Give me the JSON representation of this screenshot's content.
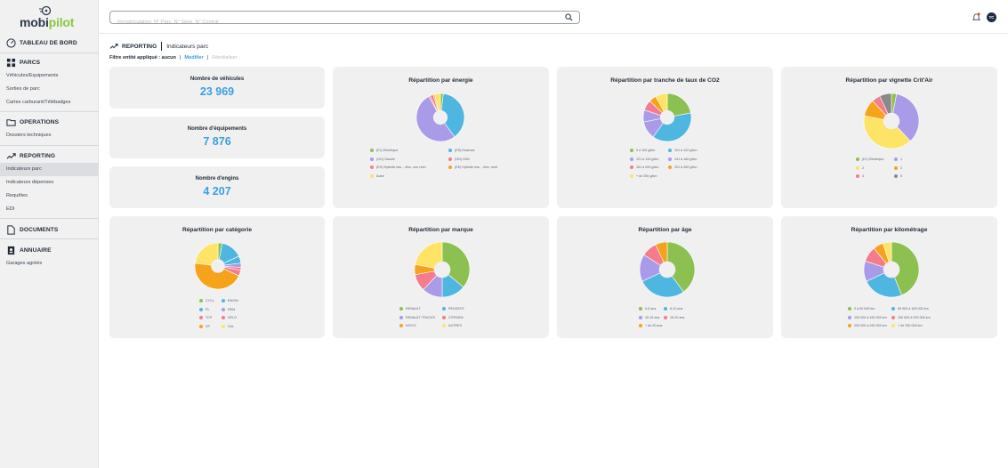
{
  "brand": {
    "name_part1": "mobi",
    "name_part2": "pilot"
  },
  "sidebar": {
    "sections": [
      {
        "icon": "gauge-icon",
        "title": "TABLEAU DE BORD",
        "items": []
      },
      {
        "icon": "grid-icon",
        "title": "PARCS",
        "items": [
          "Véhicules/Equipements",
          "Sorties de parc",
          "Cartes carburant/Télébadges"
        ]
      },
      {
        "icon": "folder-icon",
        "title": "OPERATIONS",
        "items": [
          "Dossiers techniques"
        ]
      },
      {
        "icon": "trend-icon",
        "title": "REPORTING",
        "items": [
          "Indicateurs parc",
          "Indicateurs dépenses",
          "Requêtes",
          "EDI"
        ]
      },
      {
        "icon": "document-icon",
        "title": "DOCUMENTS",
        "items": []
      },
      {
        "icon": "contacts-icon",
        "title": "ANNUAIRE",
        "items": [
          "Garages agréés"
        ]
      }
    ],
    "active_item": "Indicateurs parc"
  },
  "topbar": {
    "search_placeholder": "Immatriculation, N° Parc, N° Série, N° Contrat",
    "avatar_initials": "TC"
  },
  "header": {
    "section": "REPORTING",
    "page": "Indicateurs parc",
    "filter_label": "Filtre entité appliqué : aucun",
    "separator": "|",
    "modify": "Modifier",
    "reset": "Réinitialiser"
  },
  "kpis": [
    {
      "label": "Nombre de véhicules",
      "value": "23 969"
    },
    {
      "label": "Nombre d'équipements",
      "value": "7 876"
    },
    {
      "label": "Nombre d'engins",
      "value": "4 207"
    }
  ],
  "colors": {
    "green": "#8cc152",
    "blue": "#4fb6e0",
    "purple": "#a99be8",
    "pink": "#f47c8c",
    "yellow": "#fde466",
    "orange": "#f7a21b",
    "gray": "#8a8a8a",
    "accent": "#3aa0e0"
  },
  "chart_data": [
    {
      "type": "pie",
      "title": "Répartition par énergie",
      "labels": [
        "(EL) Electrique",
        "(ES) Essence",
        "(GO) Gazole",
        "(GN) GNV",
        "(EH) Hybride ess. - élec. non rech.",
        "(EE) Hybride ess. - élec. rech.",
        "Autre"
      ],
      "values": [
        2,
        38,
        52,
        1,
        2,
        1,
        4
      ],
      "colors": [
        "#8cc152",
        "#4fb6e0",
        "#a99be8",
        "#f47c8c",
        "#f47c8c",
        "#f7a21b",
        "#fde466"
      ]
    },
    {
      "type": "pie",
      "title": "Répartition par tranche de taux de CO2",
      "labels": [
        "0 à 100 g/km",
        "101 à 120 g/km",
        "121 à 140 g/km",
        "141 à 160 g/km",
        "161 à 200 g/km",
        "201 à 250 g/km",
        "+ de 250 g/km"
      ],
      "values": [
        22,
        38,
        12,
        8,
        7,
        5,
        8
      ],
      "colors": [
        "#8cc152",
        "#4fb6e0",
        "#a99be8",
        "#a99be8",
        "#f47c8c",
        "#f7a21b",
        "#fde466"
      ]
    },
    {
      "type": "pie",
      "title": "Répartition par vignette Crit'Air",
      "labels": [
        "(EL) Electrique",
        "1",
        "2",
        "3",
        "4",
        "5"
      ],
      "values": [
        3,
        35,
        40,
        10,
        5,
        7
      ],
      "colors": [
        "#8cc152",
        "#a99be8",
        "#fde466",
        "#f7a21b",
        "#f47c8c",
        "#8a8a8a"
      ]
    },
    {
      "type": "pie",
      "title": "Répartition par catégorie",
      "labels": [
        "CYCL",
        "ENGIN",
        "PL",
        "REM",
        "TCP",
        "VELO",
        "VP",
        "VUL"
      ],
      "values": [
        3,
        15,
        5,
        3,
        2,
        4,
        45,
        23
      ],
      "colors": [
        "#8cc152",
        "#4fb6e0",
        "#4fb6e0",
        "#a99be8",
        "#f47c8c",
        "#f47c8c",
        "#f7a21b",
        "#fde466"
      ]
    },
    {
      "type": "pie",
      "title": "Répartition par marque",
      "labels": [
        "RENAULT",
        "PEUGEOT",
        "RENAULT TRUCKS",
        "CITROEN",
        "IVECO",
        "AUTRES"
      ],
      "values": [
        36,
        14,
        12,
        10,
        6,
        22
      ],
      "colors": [
        "#8cc152",
        "#4fb6e0",
        "#a99be8",
        "#f47c8c",
        "#f7a21b",
        "#fde466"
      ]
    },
    {
      "type": "pie",
      "title": "Répartition par âge",
      "labels": [
        "0-5 ans",
        "6-10 ans",
        "10-15 ans",
        "15-20 ans",
        "+ de 20 ans"
      ],
      "values": [
        40,
        28,
        16,
        9,
        7
      ],
      "colors": [
        "#8cc152",
        "#4fb6e0",
        "#a99be8",
        "#f47c8c",
        "#f7a21b"
      ]
    },
    {
      "type": "pie",
      "title": "Répartition par kilométrage",
      "labels": [
        "0 à 50 000 km",
        "50 000 à 100 000 km",
        "100 000 à 150 000 km",
        "150 000 à 200 000 km",
        "200 000 à 250 000 km",
        "+ de 250 000 km"
      ],
      "values": [
        44,
        24,
        12,
        9,
        6,
        5
      ],
      "colors": [
        "#8cc152",
        "#4fb6e0",
        "#a99be8",
        "#f47c8c",
        "#f7a21b",
        "#fde466"
      ]
    }
  ]
}
